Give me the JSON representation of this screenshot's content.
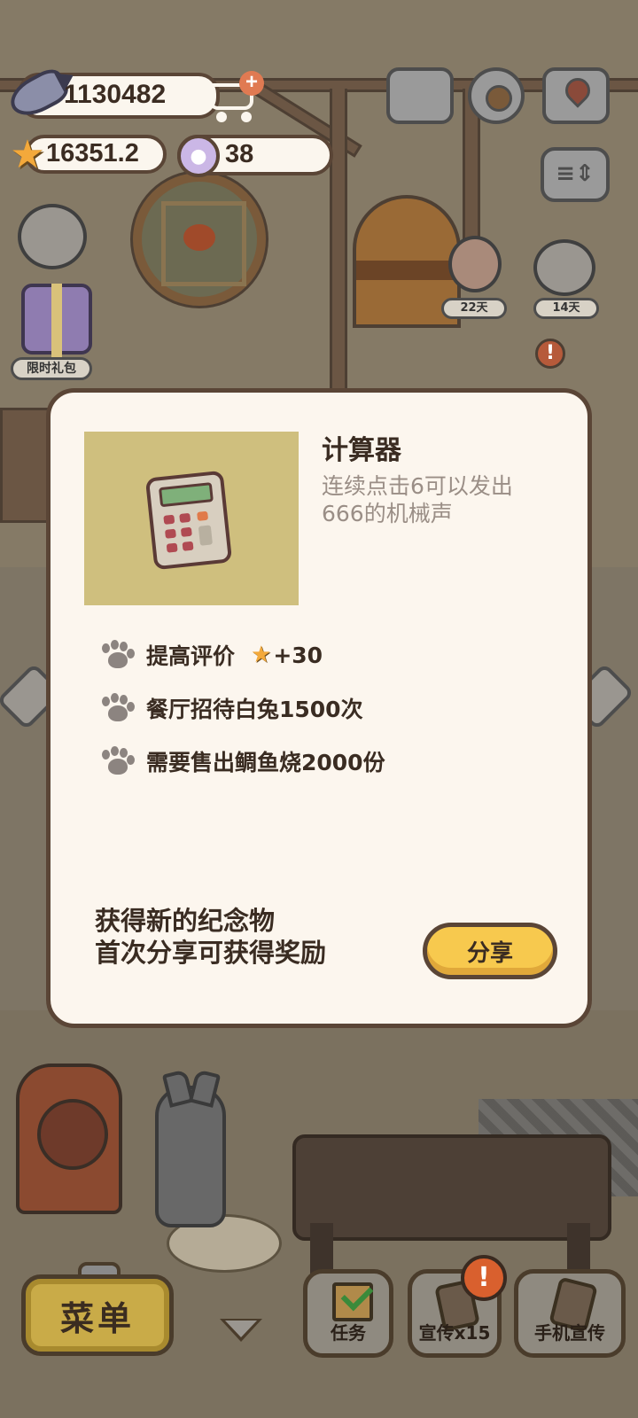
{
  "hud": {
    "fish_currency": "1130482",
    "star_rating": "16351.2",
    "paw_tokens": "38"
  },
  "scene": {
    "gift_pack_label": "限时礼包",
    "timer_badges": [
      "22天",
      "14天"
    ]
  },
  "modal": {
    "item_name": "计算器",
    "item_description": "连续点击6可以发出666的机械声",
    "requirements": [
      {
        "text": "提高评价",
        "reward": "+30"
      },
      {
        "text": "餐厅招待白兔1500次"
      },
      {
        "text": "需要售出鲷鱼烧2000份"
      }
    ],
    "share_message_line1": "获得新的纪念物",
    "share_message_line2": "首次分享可获得奖励",
    "share_button": "分享"
  },
  "bottom_bar": {
    "menu_label": "菜单",
    "task_label": "任务",
    "promo_label": "宣传x15",
    "phone_promo_label": "手机宣传"
  },
  "colors": {
    "modal_bg": "#fcf6ee",
    "share_button": "#f7c94e",
    "star": "#f3a93b",
    "alert": "#d9602e"
  },
  "icons": [
    "fish-icon",
    "cart-icon",
    "star-icon",
    "paw-icon",
    "book-icon",
    "gear-icon",
    "map-icon",
    "sort-icon",
    "calculator-icon",
    "checklist-icon",
    "phone-icon"
  ]
}
